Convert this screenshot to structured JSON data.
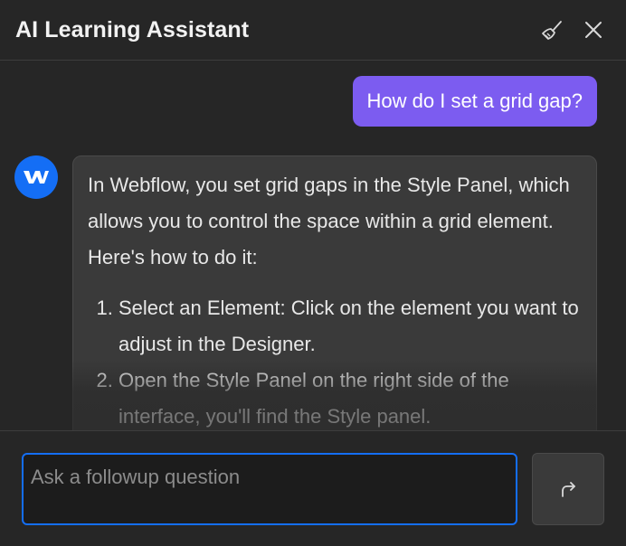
{
  "header": {
    "title": "AI Learning Assistant",
    "clear_icon": "broom-icon",
    "close_icon": "close-icon"
  },
  "messages": {
    "user": {
      "text": "How do I set a grid gap?"
    },
    "assistant": {
      "avatar_icon": "webflow-logo-icon",
      "intro": "In Webflow, you set grid gaps in the Style Panel, which allows you to control the space within a grid element. Here's how to do it:",
      "steps": [
        "Select an Element: Click on the element you want to adjust in the Designer.",
        "Open the Style Panel on the right side of the interface, you'll find the Style panel."
      ]
    }
  },
  "composer": {
    "placeholder": "Ask a followup question",
    "value": "",
    "send_icon": "send-arrow-icon"
  },
  "colors": {
    "background": "#262626",
    "user_bubble": "#7c5cf0",
    "assistant_bubble": "#3a3a3a",
    "accent": "#146ef5"
  }
}
